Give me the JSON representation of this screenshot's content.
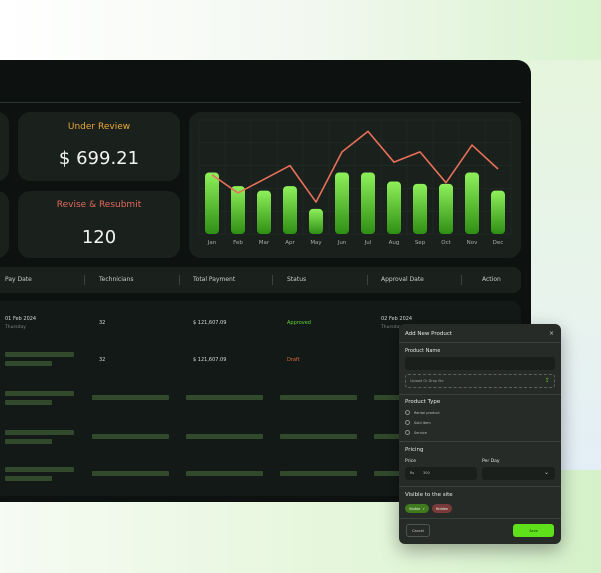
{
  "cards": {
    "under_review": {
      "label": "Under Review",
      "value": "$ 699.21",
      "color": "#e8a93a"
    },
    "revise": {
      "label": "Revise & Resubmit",
      "value": "120",
      "color": "#e06a5b"
    }
  },
  "chart_data": {
    "type": "bar",
    "categories": [
      "Jan",
      "Feb",
      "Mar",
      "Apr",
      "May",
      "Jun",
      "Jul",
      "Aug",
      "Sep",
      "Oct",
      "Nov",
      "Dec"
    ],
    "series": [
      {
        "type": "bar",
        "values": [
          54,
          42,
          38,
          42,
          22,
          54,
          54,
          46,
          44,
          44,
          54,
          38
        ],
        "color": "#7de84a"
      },
      {
        "type": "line",
        "values": [
          52,
          36,
          48,
          60,
          28,
          72,
          90,
          63,
          72,
          45,
          78,
          57
        ],
        "color": "#e8705a"
      }
    ],
    "ylim": [
      0,
      100
    ],
    "grid": true,
    "title": "",
    "xlabel": "",
    "ylabel": ""
  },
  "table": {
    "headers": [
      "Pay Date",
      "Technicians",
      "Total Payment",
      "Status",
      "Approval Date",
      "Action"
    ],
    "rows": [
      {
        "pay_date": "01 Feb 2024",
        "pay_day": "Thursday",
        "technicians": "32",
        "total": "$ 121,607.09",
        "status": "Approved",
        "status_color": "#5fd33a",
        "approval_date": "02 Feb 2024",
        "approval_day": "Thursday"
      },
      {
        "technicians": "32",
        "total": "$ 121,607.09",
        "status": "Draft",
        "status_color": "#e06a3a"
      }
    ]
  },
  "modal": {
    "title": "Add New Product",
    "close": "×",
    "product_name_label": "Product Name",
    "upload_label": "Upload Or Drop file",
    "product_type_label": "Product Type",
    "types": [
      "Rental product",
      "Sold Item",
      "Service"
    ],
    "pricing_label": "Pricing",
    "price_label": "Price",
    "price_currency": "Rs",
    "price_value": "300",
    "per_day_label": "Per Day",
    "visible_label": "Visible to the site",
    "visible_yes": "Visible",
    "visible_no": "Hidden",
    "cancel_label": "Cancel",
    "save_label": "Save"
  }
}
